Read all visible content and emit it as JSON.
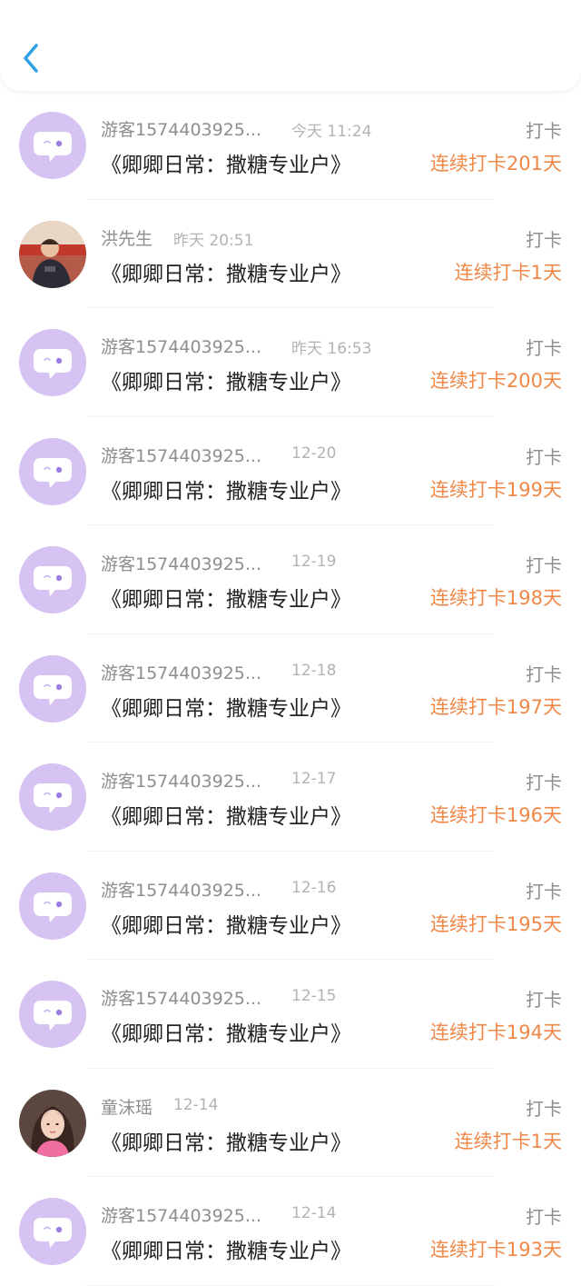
{
  "header": {
    "back_icon": "chevron-left-icon",
    "accent_color": "#2ea0e8"
  },
  "colors": {
    "streak": "#f08848",
    "avatar_bg": "#d6c3f3",
    "avatar_glyph": "#9c7fe0"
  },
  "items": [
    {
      "user": "游客1574403925...",
      "time": "今天 11:24",
      "title": "《卿卿日常：撒糖专业户》",
      "tag": "打卡",
      "streak": "连续打卡201天",
      "avatar": "default-chat-avatar"
    },
    {
      "user": "洪先生",
      "time": "昨天 20:51",
      "title": "《卿卿日常：撒糖专业户》",
      "tag": "打卡",
      "streak": "连续打卡1天",
      "avatar": "child-photo-avatar"
    },
    {
      "user": "游客1574403925...",
      "time": "昨天 16:53",
      "title": "《卿卿日常：撒糖专业户》",
      "tag": "打卡",
      "streak": "连续打卡200天",
      "avatar": "default-chat-avatar"
    },
    {
      "user": "游客1574403925...",
      "time": "12-20",
      "title": "《卿卿日常：撒糖专业户》",
      "tag": "打卡",
      "streak": "连续打卡199天",
      "avatar": "default-chat-avatar"
    },
    {
      "user": "游客1574403925...",
      "time": "12-19",
      "title": "《卿卿日常：撒糖专业户》",
      "tag": "打卡",
      "streak": "连续打卡198天",
      "avatar": "default-chat-avatar"
    },
    {
      "user": "游客1574403925...",
      "time": "12-18",
      "title": "《卿卿日常：撒糖专业户》",
      "tag": "打卡",
      "streak": "连续打卡197天",
      "avatar": "default-chat-avatar"
    },
    {
      "user": "游客1574403925...",
      "time": "12-17",
      "title": "《卿卿日常：撒糖专业户》",
      "tag": "打卡",
      "streak": "连续打卡196天",
      "avatar": "default-chat-avatar"
    },
    {
      "user": "游客1574403925...",
      "time": "12-16",
      "title": "《卿卿日常：撒糖专业户》",
      "tag": "打卡",
      "streak": "连续打卡195天",
      "avatar": "default-chat-avatar"
    },
    {
      "user": "游客1574403925...",
      "time": "12-15",
      "title": "《卿卿日常：撒糖专业户》",
      "tag": "打卡",
      "streak": "连续打卡194天",
      "avatar": "default-chat-avatar"
    },
    {
      "user": "童沫瑶",
      "time": "12-14",
      "title": "《卿卿日常：撒糖专业户》",
      "tag": "打卡",
      "streak": "连续打卡1天",
      "avatar": "girl-photo-avatar"
    },
    {
      "user": "游客1574403925...",
      "time": "12-14",
      "title": "《卿卿日常：撒糖专业户》",
      "tag": "打卡",
      "streak": "连续打卡193天",
      "avatar": "default-chat-avatar"
    }
  ]
}
